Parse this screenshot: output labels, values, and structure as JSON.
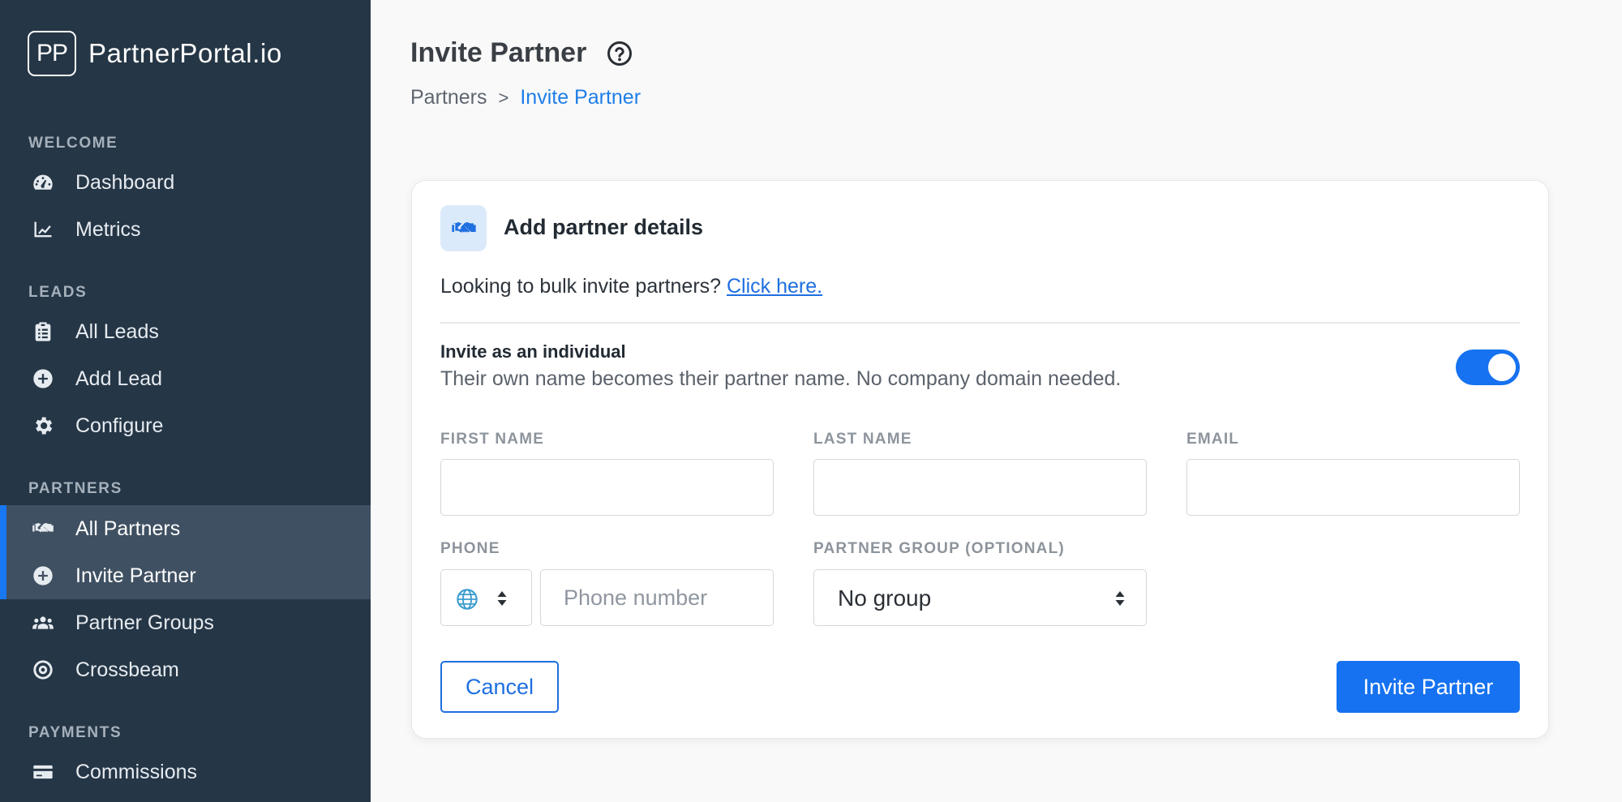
{
  "brand": {
    "logo_text": "PP",
    "name": "PartnerPortal.io"
  },
  "sidebar": {
    "sections": [
      {
        "label": "WELCOME"
      },
      {
        "label": "LEADS"
      },
      {
        "label": "PARTNERS"
      },
      {
        "label": "PAYMENTS"
      }
    ],
    "items": [
      {
        "label": "Dashboard",
        "icon": "gauge-icon"
      },
      {
        "label": "Metrics",
        "icon": "chart-line-icon"
      },
      {
        "label": "All Leads",
        "icon": "clipboard-icon"
      },
      {
        "label": "Add Lead",
        "icon": "plus-circle-icon"
      },
      {
        "label": "Configure",
        "icon": "gear-icon"
      },
      {
        "label": "All Partners",
        "icon": "handshake-icon"
      },
      {
        "label": "Invite Partner",
        "icon": "plus-circle-icon",
        "active": true
      },
      {
        "label": "Partner Groups",
        "icon": "users-icon"
      },
      {
        "label": "Crossbeam",
        "icon": "target-icon"
      },
      {
        "label": "Commissions",
        "icon": "credit-card-icon"
      }
    ]
  },
  "header": {
    "title": "Invite Partner",
    "breadcrumb": {
      "parent": "Partners",
      "separator": ">",
      "current": "Invite Partner"
    }
  },
  "card": {
    "title": "Add partner details",
    "bulk_text": "Looking to bulk invite partners?",
    "bulk_link": "Click here.",
    "individual": {
      "title": "Invite as an individual",
      "description": "Their own name becomes their partner name. No company domain needed.",
      "toggle_on": true
    },
    "fields": {
      "first_name": {
        "label": "FIRST NAME",
        "value": ""
      },
      "last_name": {
        "label": "LAST NAME",
        "value": ""
      },
      "email": {
        "label": "EMAIL",
        "value": ""
      },
      "phone": {
        "label": "PHONE",
        "placeholder": "Phone number",
        "value": ""
      },
      "partner_group": {
        "label": "PARTNER GROUP (OPTIONAL)",
        "value": "No group"
      }
    },
    "buttons": {
      "cancel": "Cancel",
      "submit": "Invite Partner"
    }
  },
  "colors": {
    "sidebar_bg": "#253646",
    "sidebar_active_bg": "#3f5062",
    "accent": "#1672f0",
    "link": "#1f6fe0"
  }
}
